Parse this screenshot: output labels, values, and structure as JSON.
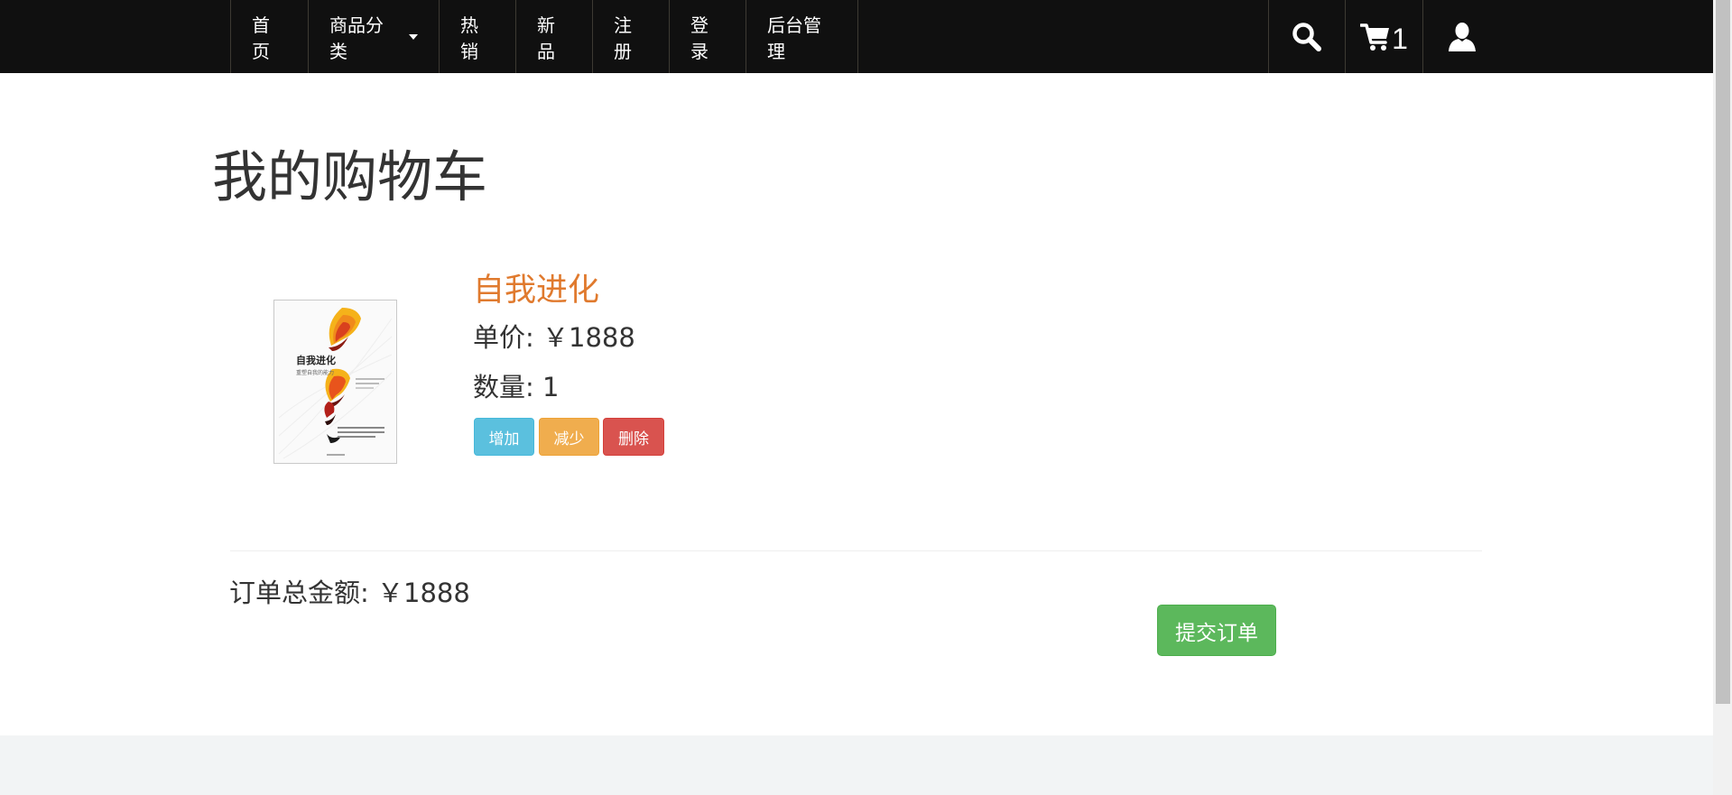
{
  "nav": {
    "items": [
      {
        "label": "首页"
      },
      {
        "label": "商品分类",
        "dropdown": true
      },
      {
        "label": "热销"
      },
      {
        "label": "新品"
      },
      {
        "label": "注册"
      },
      {
        "label": "登录"
      },
      {
        "label": "后台管理"
      }
    ],
    "search_icon": "search-icon",
    "cart_icon": "cart-icon",
    "cart_count": "1",
    "user_icon": "user-icon"
  },
  "page": {
    "title": "我的购物车"
  },
  "cart": {
    "items": [
      {
        "name": "自我进化",
        "price_text": "单价: ￥1888",
        "quantity_text": "数量: 1",
        "cover": {
          "title": "自我进化",
          "subtitle": "重塑自我的能力"
        }
      }
    ],
    "buttons": {
      "add": "增加",
      "minus": "减少",
      "delete": "删除"
    },
    "total_text": "订单总金额: ￥1888",
    "submit": "提交订单"
  },
  "colors": {
    "navbar": "#101010",
    "product_name": "#e07a2e",
    "add": "#5bc0de",
    "minus": "#f0ad4e",
    "delete": "#d9534f",
    "submit": "#5cb85c"
  }
}
